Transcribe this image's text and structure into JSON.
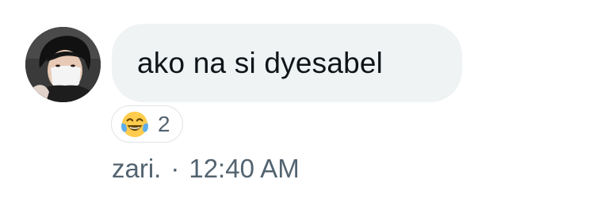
{
  "message": {
    "sender_avatar": "avatar-photo",
    "text": "ako na si dyesabel",
    "reaction": {
      "emoji": "face-with-tears-of-joy-icon",
      "count": "2"
    },
    "sender_name": "zari.",
    "separator": "·",
    "timestamp": "12:40 AM"
  },
  "colors": {
    "bubble_background": "#eff3f4",
    "text_primary": "#0f1419",
    "text_secondary": "#536471",
    "reaction_border": "#dfe4e7"
  }
}
